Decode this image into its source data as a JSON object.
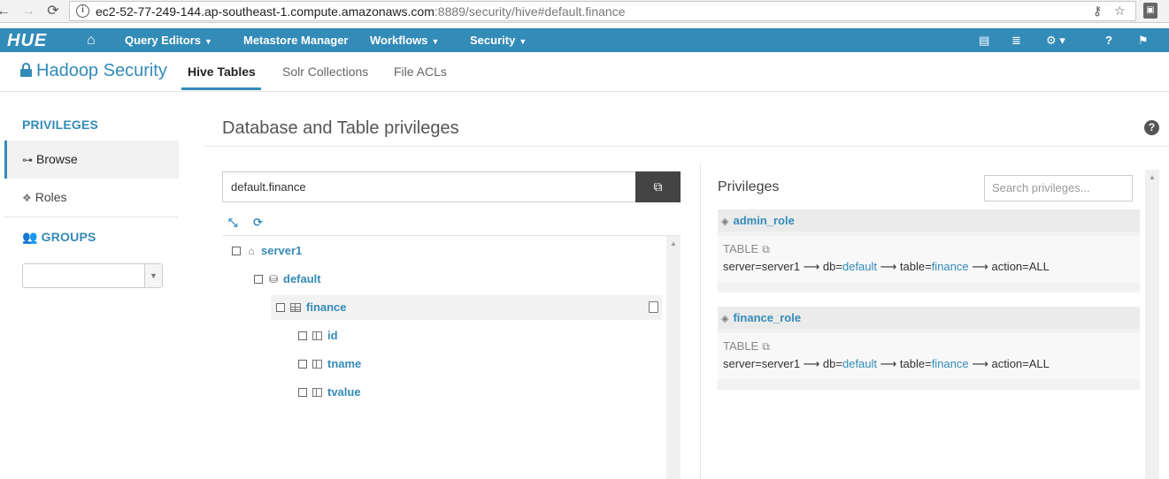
{
  "browser": {
    "url_host": "ec2-52-77-249-144.ap-southeast-1.compute.amazonaws.com",
    "url_path": ":8889/security/hive#default.finance"
  },
  "nav": {
    "logo": "HUE",
    "items": [
      {
        "label": "Query Editors"
      },
      {
        "label": "Metastore Manager"
      },
      {
        "label": "Workflows"
      },
      {
        "label": "Security"
      }
    ]
  },
  "header": {
    "app_title": "Hadoop Security",
    "tabs": [
      {
        "label": "Hive Tables",
        "active": true
      },
      {
        "label": "Solr Collections"
      },
      {
        "label": "File ACLs"
      }
    ]
  },
  "sidebar": {
    "privileges_heading": "PRIVILEGES",
    "items": [
      {
        "label": "Browse",
        "active": true
      },
      {
        "label": "Roles"
      }
    ],
    "groups_heading": "GROUPS",
    "groups_select_value": ""
  },
  "main": {
    "title": "Database and Table privileges",
    "path_value": "default.finance",
    "tree": [
      {
        "label": "server1",
        "type": "server"
      },
      {
        "label": "default",
        "type": "database"
      },
      {
        "label": "finance",
        "type": "table",
        "selected": true
      },
      {
        "label": "id",
        "type": "column"
      },
      {
        "label": "tname",
        "type": "column"
      },
      {
        "label": "tvalue",
        "type": "column"
      }
    ]
  },
  "privileges": {
    "title": "Privileges",
    "search_placeholder": "Search privileges...",
    "roles": [
      {
        "name": "admin_role",
        "type": "TABLE",
        "server_part": "server=server1 ⟶ db=",
        "db": "default",
        "table_part": " ⟶ table=",
        "table": "finance",
        "action_part": " ⟶ action=ALL"
      },
      {
        "name": "finance_role",
        "type": "TABLE",
        "server_part": "server=server1 ⟶ db=",
        "db": "default",
        "table_part": " ⟶ table=",
        "table": "finance",
        "action_part": " ⟶ action=ALL"
      }
    ]
  },
  "colors": {
    "brand": "#338bb8",
    "dark_button": "#444444"
  }
}
